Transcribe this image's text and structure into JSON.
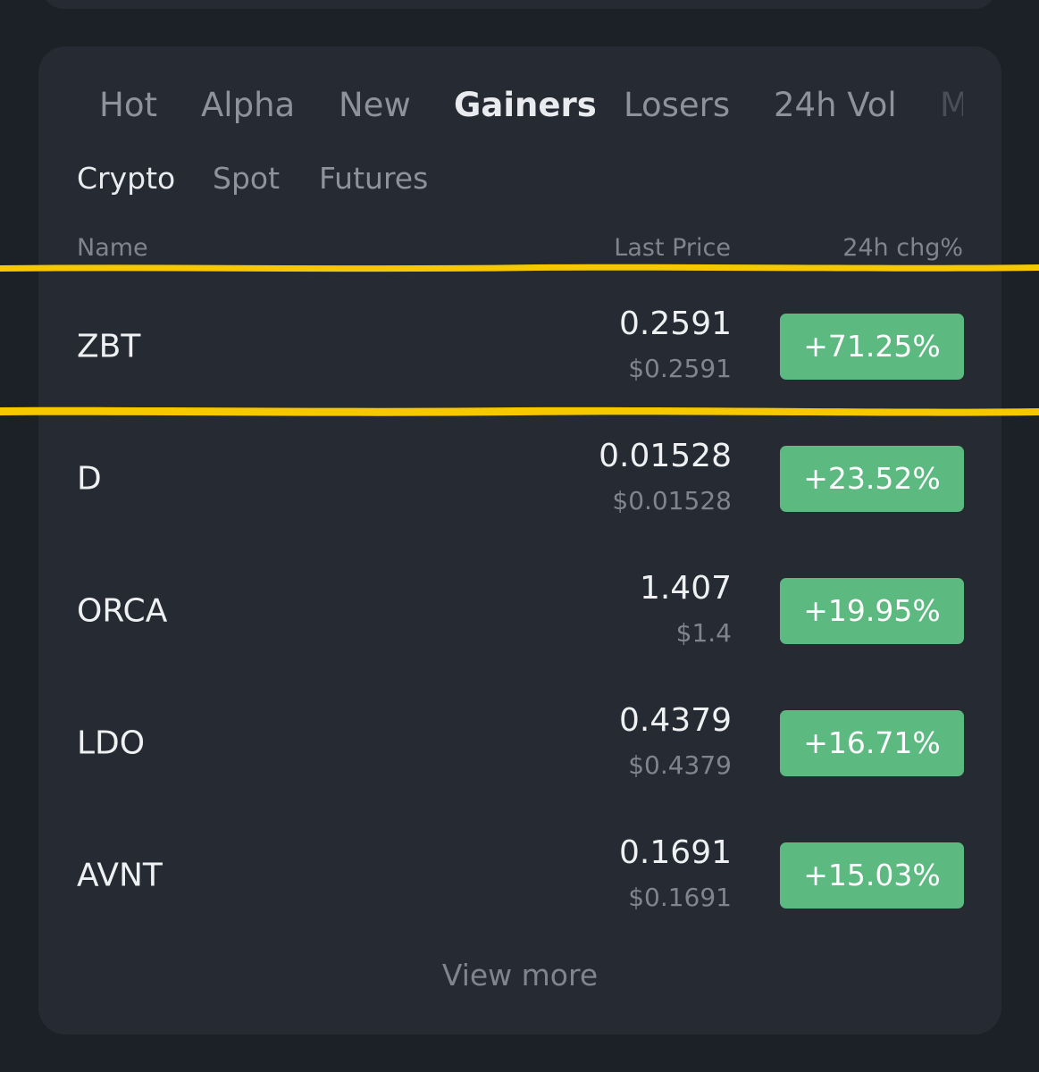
{
  "main_tabs": [
    {
      "label": "Hot",
      "active": false
    },
    {
      "label": "Alpha",
      "active": false
    },
    {
      "label": "New",
      "active": false
    },
    {
      "label": "Gainers",
      "active": true
    },
    {
      "label": "Losers",
      "active": false
    },
    {
      "label": "24h Vol",
      "active": false
    },
    {
      "label": "M",
      "active": false
    }
  ],
  "sub_tabs": [
    {
      "label": "Crypto",
      "active": true
    },
    {
      "label": "Spot",
      "active": false
    },
    {
      "label": "Futures",
      "active": false
    }
  ],
  "columns": {
    "name": "Name",
    "last_price": "Last Price",
    "change": "24h chg%"
  },
  "rows": [
    {
      "symbol": "ZBT",
      "price": "0.2591",
      "usd": "$0.2591",
      "change": "+71.25%"
    },
    {
      "symbol": "D",
      "price": "0.01528",
      "usd": "$0.01528",
      "change": "+23.52%"
    },
    {
      "symbol": "ORCA",
      "price": "1.407",
      "usd": "$1.4",
      "change": "+19.95%"
    },
    {
      "symbol": "LDO",
      "price": "0.4379",
      "usd": "$0.4379",
      "change": "+16.71%"
    },
    {
      "symbol": "AVNT",
      "price": "0.1691",
      "usd": "$0.1691",
      "change": "+15.03%"
    }
  ],
  "view_more": "View more",
  "colors": {
    "background": "#1c2027",
    "card": "#252a33",
    "positive": "#5cb97f",
    "highlight": "#f5c800"
  }
}
